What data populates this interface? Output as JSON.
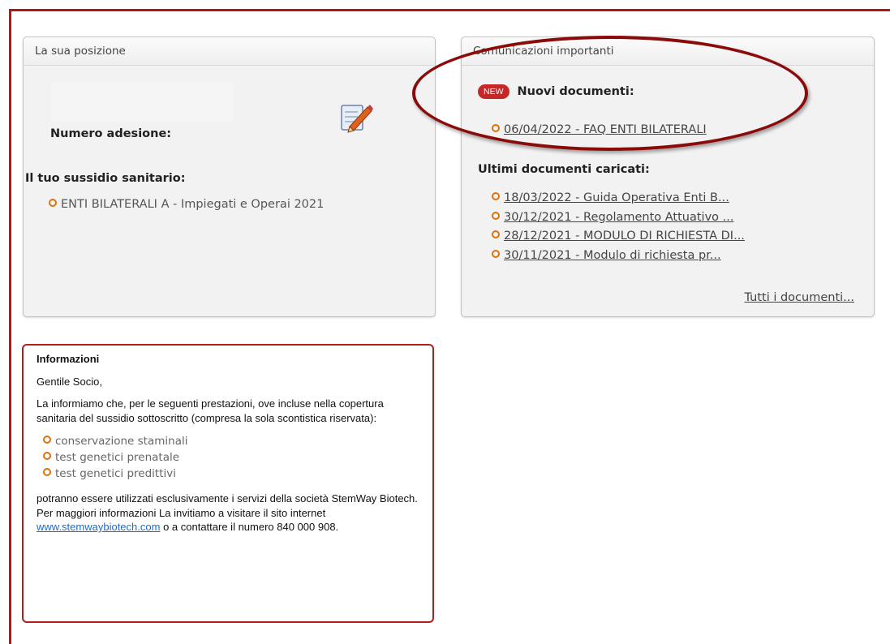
{
  "position_panel": {
    "title": "La sua posizione",
    "membership_label": "Numero adesione:",
    "subsidy_label": "Il tuo sussidio sanitario:",
    "plan": "ENTI BILATERALI A - Impiegati e Operai 2021",
    "edit_icon": "edit-icon"
  },
  "comms_panel": {
    "title": "Comunicazioni importanti",
    "new_badge": "NEW",
    "new_title": "Nuovi documenti:",
    "new_docs": [
      "06/04/2022 - FAQ ENTI BILATERALI"
    ],
    "latest_title": "Ultimi documenti caricati:",
    "latest_docs": [
      "18/03/2022 - Guida Operativa Enti B...",
      "30/12/2021 - Regolamento Attuativo ...",
      "28/12/2021 - MODULO DI RICHIESTA DI...",
      "30/11/2021 - Modulo di richiesta pr..."
    ],
    "all_docs": "Tutti i documenti..."
  },
  "info": {
    "title": "Informazioni",
    "greeting": "Gentile Socio,",
    "intro": "La informiamo che, per le seguenti prestazioni, ove incluse nella copertura sanitaria del sussidio sottoscritto (compresa la sola scontistica riservata):",
    "services": [
      "conservazione staminali",
      "test genetici prenatale",
      "test genetici predittivi"
    ],
    "closing_a": "potranno essere utilizzati esclusivamente i servizi della società StemWay Biotech. Per maggiori informazioni La invitiamo a visitare il sito internet ",
    "website": "www.stemwaybiotech.com",
    "closing_b": " o a contattare il numero 840 000 908."
  },
  "colors": {
    "frame": "#b01818",
    "annotation_oval": "#8b0a0a",
    "bullet": "#d9730d",
    "badge": "#c62828",
    "link": "#1a6ec8"
  }
}
